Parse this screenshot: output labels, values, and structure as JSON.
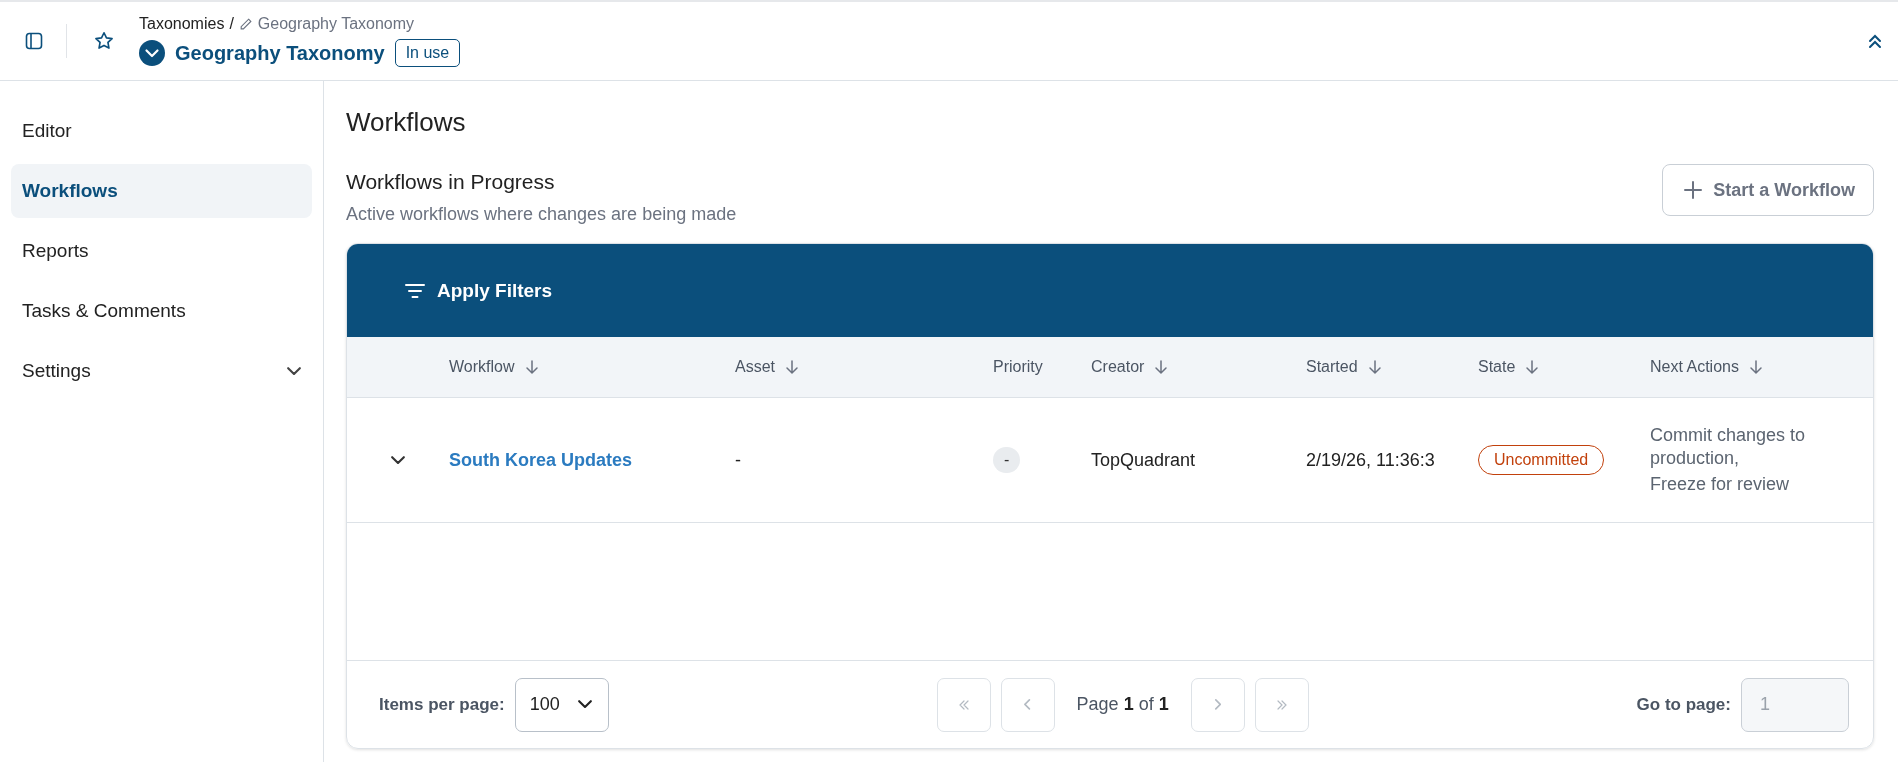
{
  "header": {
    "breadcrumb": {
      "parent": "Taxonomies",
      "separator": "/",
      "current": "Geography Taxonomy"
    },
    "title": "Geography Taxonomy",
    "badge": "In use"
  },
  "sidebar": {
    "items": [
      {
        "label": "Editor",
        "selected": false,
        "kind": "link"
      },
      {
        "label": "Workflows",
        "selected": true,
        "kind": "link"
      },
      {
        "label": "Reports",
        "selected": false,
        "kind": "link"
      },
      {
        "label": "Tasks & Comments",
        "selected": false,
        "kind": "link"
      },
      {
        "label": "Settings",
        "selected": false,
        "kind": "group",
        "expanded": false
      }
    ]
  },
  "page": {
    "title": "Workflows",
    "section_title": "Workflows in Progress",
    "section_subtitle": "Active workflows where changes are being made",
    "start_button": "Start a Workflow"
  },
  "table": {
    "filter_button": "Apply Filters",
    "columns": [
      {
        "label": "Workflow",
        "sortable": true
      },
      {
        "label": "Asset",
        "sortable": true
      },
      {
        "label": "Priority",
        "sortable": false
      },
      {
        "label": "Creator",
        "sortable": true
      },
      {
        "label": "Started",
        "sortable": true
      },
      {
        "label": "State",
        "sortable": true
      },
      {
        "label": "Next Actions",
        "sortable": true
      }
    ],
    "rows": [
      {
        "expanded": false,
        "workflow": "South Korea Updates",
        "asset": "-",
        "priority": "-",
        "creator": "TopQuadrant",
        "started": "2/19/26, 11:36:3",
        "state": {
          "label": "Uncommitted",
          "kind": "warning"
        },
        "next_actions": [
          "Commit changes to production,",
          "Freeze for review"
        ]
      }
    ]
  },
  "pagination": {
    "items_label": "Items per page:",
    "items_value": "100",
    "page_text": "Page **1** of **1**",
    "first_disabled": true,
    "prev_disabled": true,
    "next_disabled": true,
    "last_disabled": true,
    "goto_label": "Go to page:",
    "goto_placeholder": "1"
  }
}
